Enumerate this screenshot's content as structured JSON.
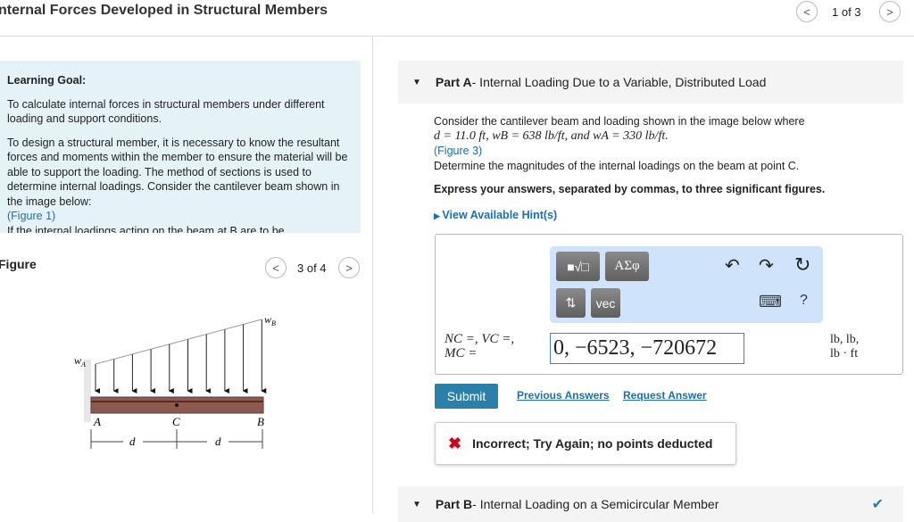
{
  "header": {
    "title": "nternal Forces Developed in Structural Members",
    "pager": "1 of 3"
  },
  "goal": {
    "heading": "Learning Goal:",
    "p1": "To calculate internal forces in structural members under different loading and support conditions.",
    "p2": "To design a structural member, it is necessary to know the resultant forces and moments within the member to ensure the material will be able to support the loading. The method of sections is used to determine internal loadings. Consider the cantilever beam shown in the image below:",
    "fig_link": "(Figure 1)",
    "p3": "If the internal loadings acting on the beam at B are to be"
  },
  "figure": {
    "heading": "Figure",
    "pager": "3 of 4",
    "labels": {
      "wa": "w",
      "wa_sub": "A",
      "wb": "w",
      "wb_sub": "B",
      "a": "A",
      "c": "C",
      "b": "B",
      "d1": "d",
      "d2": "d"
    }
  },
  "partA": {
    "label": "Part A",
    "title": " - Internal Loading Due to a Variable, Distributed Load",
    "line1": "Consider the cantilever beam and loading shown in the image below where",
    "line2": "d = 11.0 ft, wB = 638 lb/ft, and wA = 330 lb/ft.",
    "fig_link": "(Figure 3)",
    "line3": "Determine the magnitudes of the internal loadings on the beam at point C.",
    "instruction": "Express your answers, separated by commas, to three significant figures.",
    "hint": "View Available Hint(s)",
    "toolbar": {
      "templates": "■√□",
      "greek": "ΑΣφ",
      "arrows": "⇅",
      "vec": "vec",
      "undo": "↶",
      "redo": "↷",
      "reset": "↻",
      "keyboard": "⌨",
      "help": "?"
    },
    "answer_label1": "NC =, VC =,",
    "answer_label2": "MC =",
    "answer_value": "0, −6523, −720672",
    "units1": "lb, lb,",
    "units2": "lb · ft",
    "submit": "Submit",
    "previous": "Previous Answers",
    "request": "Request Answer",
    "feedback": "Incorrect; Try Again; no points deducted"
  },
  "partB": {
    "label": "Part B",
    "title": " - Internal Loading on a Semicircular Member",
    "status": "✔"
  },
  "colors": {
    "accent": "#2a80a8",
    "error": "#d0021b",
    "check": "#2a7ab0"
  }
}
